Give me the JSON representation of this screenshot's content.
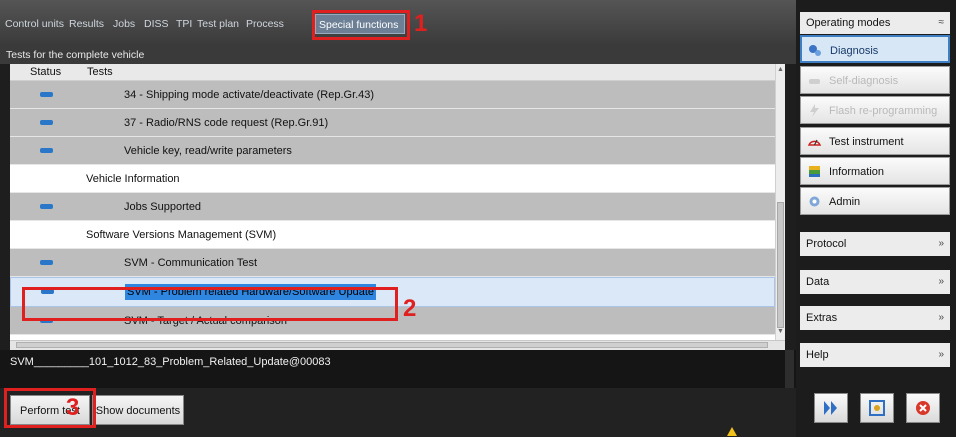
{
  "tabs": [
    {
      "label": "Control units"
    },
    {
      "label": "Results"
    },
    {
      "label": "Jobs"
    },
    {
      "label": "DISS"
    },
    {
      "label": "TPI"
    },
    {
      "label": "Test plan"
    },
    {
      "label": "Process"
    },
    {
      "label": "Special functions",
      "active": true
    }
  ],
  "subheader": "Tests for the complete vehicle",
  "table": {
    "columns": [
      "Status",
      "Tests"
    ],
    "rows": [
      {
        "label": "34 - Shipping mode activate/deactivate (Rep.Gr.43)",
        "status": "blue-dash"
      },
      {
        "label": "37 - Radio/RNS code request (Rep.Gr.91)",
        "status": "blue-dash"
      },
      {
        "label": "Vehicle key, read/write parameters",
        "status": "blue-dash"
      },
      {
        "label": "Vehicle Information"
      },
      {
        "label": "Jobs Supported",
        "status": "blue-dash"
      },
      {
        "label": "Software Versions Management (SVM)"
      },
      {
        "label": "SVM - Communication Test",
        "status": "blue-dash"
      },
      {
        "label": "SVM - Problem related Hardware/Software Update",
        "status": "blue-dash",
        "selected": true
      },
      {
        "label": "SVM - Target / Actual comparison",
        "status": "blue-dash"
      }
    ]
  },
  "info_text": "SVM_________101_1012_83_Problem_Related_Update@00083",
  "buttons": {
    "perform_test": "Perform test",
    "show_documents": "Show documents"
  },
  "annotations": [
    "1",
    "2",
    "3"
  ],
  "sidebar": {
    "operating_modes_header": "Operating modes",
    "modes": [
      {
        "label": "Diagnosis",
        "icon": "stethoscope-icon",
        "active": true
      },
      {
        "label": "Self-diagnosis",
        "icon": "car-icon",
        "disabled": true
      },
      {
        "label": "Flash re-programming",
        "icon": "flash-icon",
        "disabled": true
      },
      {
        "label": "Test instrument",
        "icon": "gauge-icon"
      },
      {
        "label": "Information",
        "icon": "book-icon"
      },
      {
        "label": "Admin",
        "icon": "gear-icon"
      }
    ],
    "sections": [
      {
        "label": "Protocol"
      },
      {
        "label": "Data"
      },
      {
        "label": "Extras"
      },
      {
        "label": "Help"
      }
    ]
  },
  "colors": {
    "highlight_red": "#e0201e",
    "selection_blue": "#2f86e0",
    "status_blue": "#2a77c9"
  }
}
